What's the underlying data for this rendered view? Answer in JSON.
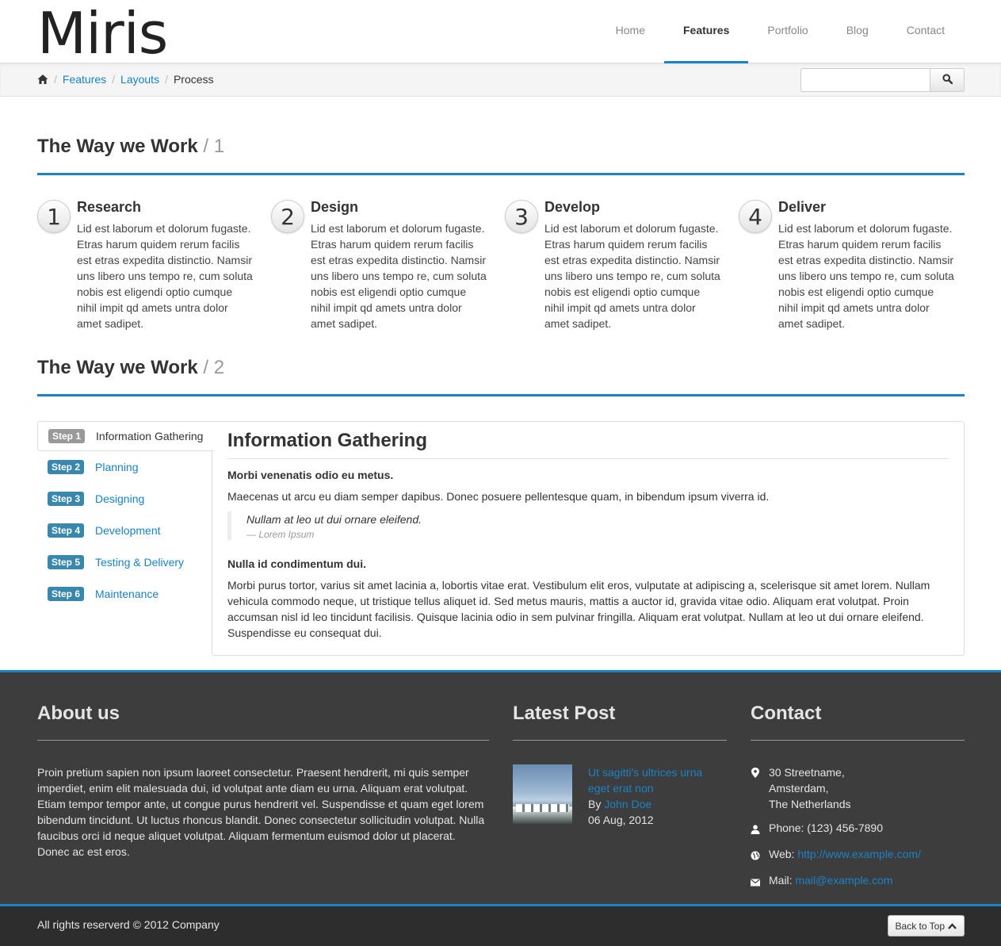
{
  "header": {
    "logo": "Miris",
    "nav": [
      {
        "label": "Home"
      },
      {
        "label": "Features",
        "active": true
      },
      {
        "label": "Portfolio"
      },
      {
        "label": "Blog"
      },
      {
        "label": "Contact"
      }
    ]
  },
  "breadcrumb": {
    "items": [
      "Features",
      "Layouts"
    ],
    "current": "Process",
    "separator": "/"
  },
  "search": {
    "placeholder": "",
    "value": ""
  },
  "section1": {
    "title": "The Way we Work",
    "num": "/ 1"
  },
  "steps": [
    {
      "num": "1",
      "title": "Research",
      "text": "Lid est laborum et dolorum fugaste. Etras harum quidem rerum facilis est etras expedita distinctio. Namsir uns libero uns tempo re, cum soluta nobis est eligendi optio cumque nihil impit qd amets untra dolor amet sadipet."
    },
    {
      "num": "2",
      "title": "Design",
      "text": "Lid est laborum et dolorum fugaste. Etras harum quidem rerum facilis est etras expedita distinctio. Namsir uns libero uns tempo re, cum soluta nobis est eligendi optio cumque nihil impit qd amets untra dolor amet sadipet."
    },
    {
      "num": "3",
      "title": "Develop",
      "text": "Lid est laborum et dolorum fugaste. Etras harum quidem rerum facilis est etras expedita distinctio. Namsir uns libero uns tempo re, cum soluta nobis est eligendi optio cumque nihil impit qd amets untra dolor amet sadipet."
    },
    {
      "num": "4",
      "title": "Deliver",
      "text": "Lid est laborum et dolorum fugaste. Etras harum quidem rerum facilis est etras expedita distinctio. Namsir uns libero uns tempo re, cum soluta nobis est eligendi optio cumque nihil impit qd amets untra dolor amet sadipet."
    }
  ],
  "section2": {
    "title": "The Way we Work",
    "num": "/ 2"
  },
  "tabs": [
    {
      "badge": "Step 1",
      "label": "Information Gathering",
      "active": true
    },
    {
      "badge": "Step 2",
      "label": "Planning"
    },
    {
      "badge": "Step 3",
      "label": "Designing"
    },
    {
      "badge": "Step 4",
      "label": "Development"
    },
    {
      "badge": "Step 5",
      "label": "Testing & Delivery"
    },
    {
      "badge": "Step 6",
      "label": "Maintenance"
    }
  ],
  "panel": {
    "title": "Information Gathering",
    "heading1": "Morbi venenatis odio eu metus.",
    "para1": "Maecenas ut arcu eu diam semper dapibus. Donec posuere pellentesque quam, in bibendum ipsum viverra id.",
    "quote": "Nullam at leo ut dui ornare eleifend.",
    "quote_source": "— Lorem Ipsum",
    "heading2": "Nulla id condimentum dui.",
    "para2": "Morbi purus tortor, varius sit amet lacinia a, lobortis vitae erat. Vestibulum elit eros, vulputate at adipiscing a, scelerisque sit amet lorem. Nullam vehicula commodo neque, ut tristique tellus aliquet id. Sed metus mauris, mattis a auctor id, gravida vitae odio. Aliquam erat volutpat. Proin accumsan nisl id leo tincidunt facilisis. Quisque lacinia odio in sem pulvinar fringilla. Aliquam erat volutpat. Nullam at leo ut dui ornare eleifend. Suspendisse eu consequat dui."
  },
  "footer": {
    "about": {
      "title": "About us",
      "text": "Proin pretium sapien non ipsum laoreet consectetur. Praesent hendrerit, mi quis semper imperdiet, enim elit malesuada dui, id volutpat ante diam eu urna. Aliquam erat volutpat. Etiam tempor tempor ante, ut congue purus hendrerit vel. Suspendisse et quam eget lorem bibendum tincidunt. Ut luctus rhoncus blandit. Donec consectetur sollicitudin volutpat. Nulla faucibus orci id neque aliquet volutpat. Aliquam fermentum euismod dolor ut placerat. Donec ac est eros."
    },
    "latest": {
      "title": "Latest Post",
      "post_title": "Ut sagitti's ultrices urna eget erat non",
      "by": "By",
      "author": "John Doe",
      "date": "06 Aug, 2012"
    },
    "contact": {
      "title": "Contact",
      "address": [
        "30 Streetname,",
        "Amsterdam,",
        "The Netherlands"
      ],
      "phone": "Phone: (123) 456-7890",
      "web_label": "Web:",
      "web": "http://www.example.com/",
      "mail_label": "Mail:",
      "mail": "mail@example.com"
    },
    "copyright": "All rights reserverd © 2012 Company",
    "back_to_top": "Back to Top"
  },
  "colors": {
    "accent": "#1a82c6",
    "footer_bg": "#3d3d3d",
    "badge": "#3a87ad"
  }
}
